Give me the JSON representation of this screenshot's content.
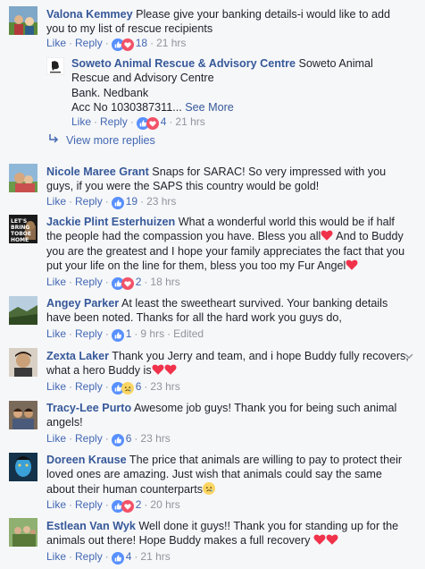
{
  "actions": {
    "like": "Like",
    "reply": "Reply",
    "see_more": "See More",
    "edited": "Edited"
  },
  "view_more_replies": "View more replies",
  "comments": [
    {
      "author": "Valona Kemmey",
      "text": "Please give your banking details-i would like to add you to my list of rescue recipients",
      "reaction_count": "18",
      "reactions": [
        "like-icon",
        "love-icon"
      ],
      "time": "21 hrs"
    },
    {
      "author": "Soweto Animal Rescue & Advisory Centre",
      "lines": [
        "Soweto Animal Rescue and Advisory Centre",
        "Bank. Nedbank",
        "Acc No 1030387311..."
      ],
      "reaction_count": "4",
      "reactions": [
        "like-icon",
        "love-icon"
      ],
      "time": "21 hrs"
    },
    {
      "author": "Nicole Maree Grant",
      "text": "Snaps for SARAC! So very impressed with you guys, if you were the SAPS this country would be gold!",
      "reaction_count": "19",
      "reactions": [
        "like-icon"
      ],
      "time": "23 hrs"
    },
    {
      "author": "Jackie Plint Esterhuizen",
      "text": "What a wonderful world this would be if half the people had the compassion you have. Bless you all",
      "text2": " And to Buddy you are the greatest and I hope your family appreciates the fact that you put your life on the line for them, bless you too my Fur Angel",
      "avatar_text": "LET'S BRING TOBOE HOME",
      "reaction_count": "2",
      "reactions": [
        "like-icon",
        "love-icon"
      ],
      "time": "18 hrs"
    },
    {
      "author": "Angey Parker",
      "text": "At least the sweetheart survived. Your banking details have been noted. Thanks for all the hard work you guys do,",
      "reaction_count": "1",
      "reactions": [
        "like-icon"
      ],
      "time": "9 hrs",
      "edited": true
    },
    {
      "author": "Zexta Laker",
      "text": "Thank you Jerry and team, and i hope Buddy fully recovers, what a hero Buddy is",
      "reaction_count": "6",
      "reactions": [
        "like-icon",
        "sad-icon"
      ],
      "time": "23 hrs"
    },
    {
      "author": "Tracy-Lee Purto",
      "text": "Awesome job guys! Thank you for being such animal angels!",
      "reaction_count": "6",
      "reactions": [
        "like-icon"
      ],
      "time": "23 hrs"
    },
    {
      "author": "Doreen Krause",
      "text": "The price that animals are willing to pay to protect their loved ones are amazing. Just wish that animals could say the same about their human counterparts",
      "reaction_count": "2",
      "reactions": [
        "like-icon",
        "love-icon"
      ],
      "time": "20 hrs"
    },
    {
      "author": "Estlean Van Wyk",
      "text": "Well done it guys!! Thank you for standing up for the animals out there! Hope Buddy makes a full recovery",
      "reaction_count": "4",
      "reactions": [
        "like-icon"
      ],
      "time": "21 hrs"
    }
  ],
  "colors": {
    "link": "#365899",
    "action": "#4267b2",
    "muted": "#90949c",
    "like_blue": "#5890ff",
    "love_red": "#f25268",
    "background": "#f6f7f9"
  }
}
